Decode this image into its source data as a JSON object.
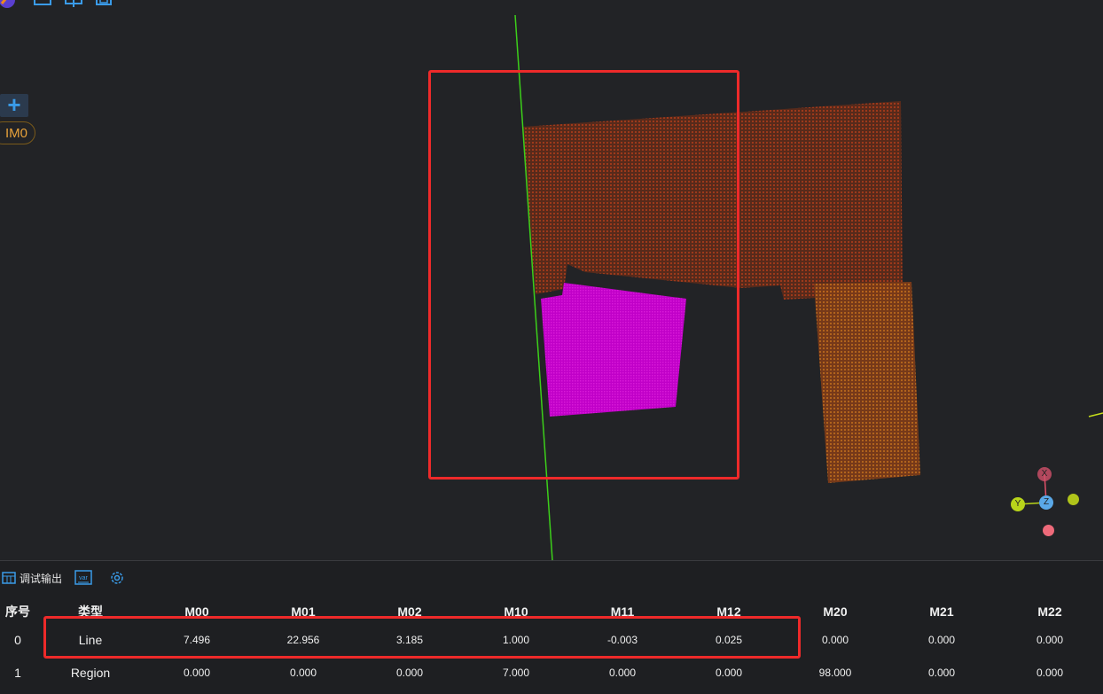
{
  "toolbar": {
    "icons": [
      "app-logo-icon",
      "window-icon",
      "layout-icon",
      "save-icon"
    ]
  },
  "viewer": {
    "add_label": "+",
    "image_badge": "IM0",
    "axes": {
      "x": "X",
      "y": "Y",
      "z": "Z"
    }
  },
  "panel": {
    "tabs": [
      {
        "label": "调试输出",
        "icon": "table-icon"
      },
      {
        "label": "",
        "icon": "var-icon"
      },
      {
        "label": "",
        "icon": "gear-icon"
      }
    ],
    "var_icon_text": "var",
    "columns": [
      "序号",
      "类型",
      "M00",
      "M01",
      "M02",
      "M10",
      "M11",
      "M12",
      "M20",
      "M21",
      "M22"
    ],
    "rows": [
      [
        "0",
        "Line",
        "7.496",
        "22.956",
        "3.185",
        "1.000",
        "-0.003",
        "0.025",
        "0.000",
        "0.000",
        "0.000"
      ],
      [
        "1",
        "Region",
        "0.000",
        "0.000",
        "0.000",
        "7.000",
        "0.000",
        "0.000",
        "98.000",
        "0.000",
        "0.000"
      ]
    ]
  },
  "colors": {
    "background": "#222326",
    "highlight": "#ee2a2a",
    "accent": "#3a9be8",
    "region": "#c200c8",
    "cloud": "#8a3a1c",
    "line": "#3ccf1a"
  }
}
